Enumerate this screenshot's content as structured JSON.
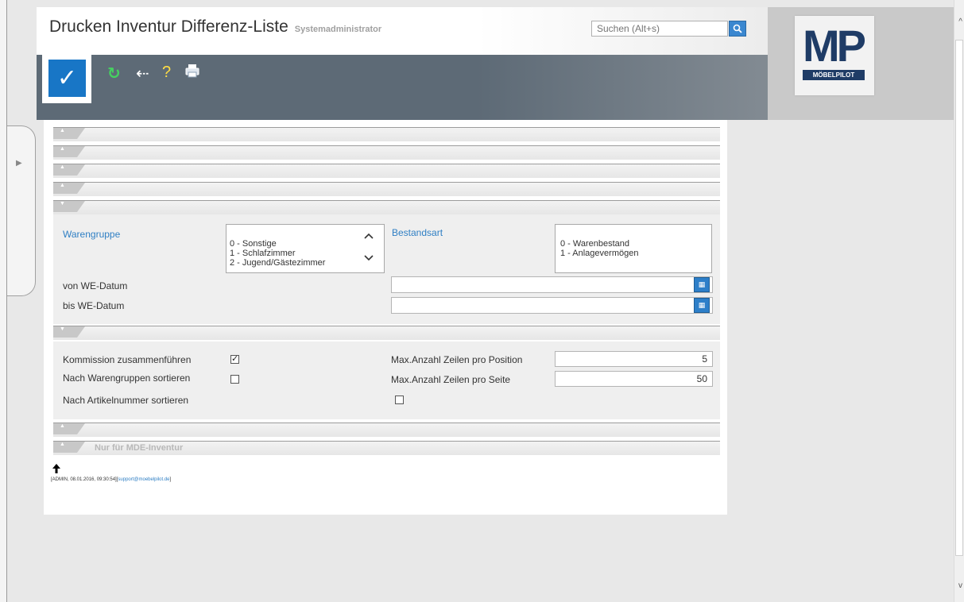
{
  "header": {
    "title": "Drucken Inventur Differenz-Liste",
    "subtitle": "Systemadministrator",
    "search_placeholder": "Suchen (Alt+s)"
  },
  "logo": {
    "mark": "MP",
    "text": "MÖBELPILOT"
  },
  "toolbar": {
    "ok_symbol": "✓",
    "refresh_symbol": "↻",
    "back_symbol": "⇠",
    "help_symbol": "?",
    "print_symbol": "▤"
  },
  "sections": [
    {
      "label": ""
    },
    {
      "label": ""
    },
    {
      "label": ""
    },
    {
      "label": ""
    },
    {
      "label": ""
    },
    {
      "label": ""
    },
    {
      "label": ""
    },
    {
      "label": "Nur für MDE-Inventur"
    }
  ],
  "filters": {
    "warengruppe_label": "Warengruppe",
    "warengruppe_options": [
      "0 - Sonstige",
      "1 - Schlafzimmer",
      "2 - Jugend/Gästezimmer"
    ],
    "bestandsart_label": "Bestandsart",
    "bestandsart_options": [
      "0 - Warenbestand",
      "1 - Anlagevermögen"
    ],
    "von_datum_label": "von WE-Datum",
    "bis_datum_label": "bis WE-Datum",
    "von_datum_value": "",
    "bis_datum_value": ""
  },
  "options": {
    "kommission_label": "Kommission zusammenführen",
    "kommission_checked": true,
    "warengruppen_sort_label": "Nach Warengruppen sortieren",
    "warengruppen_sort_checked": false,
    "artikel_sort_label": "Nach Artikelnummer sortieren",
    "artikel_sort_checked": false,
    "max_position_label": "Max.Anzahl Zeilen pro Position",
    "max_position_value": "5",
    "max_seite_label": "Max.Anzahl Zeilen pro Seite",
    "max_seite_value": "50"
  },
  "footer": {
    "up_symbol": "🡑",
    "info": "[ADMIN, 08.01.2016, 09:30:54][",
    "email": "support@moebelpilot.de",
    "info_end": "]"
  },
  "colors": {
    "header_dark": "#5d6a76",
    "accent_blue": "#1876c6",
    "link_blue": "#2f7fc4"
  }
}
